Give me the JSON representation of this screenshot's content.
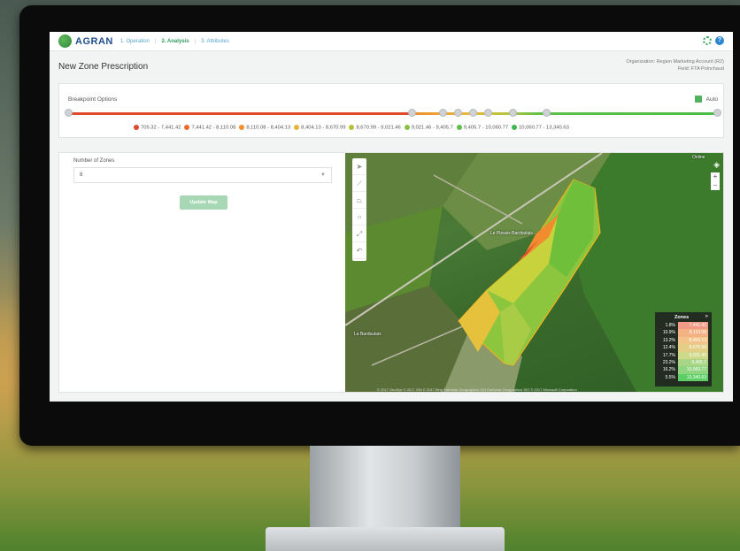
{
  "nav": {
    "brand": "AGRAN",
    "crumbs": [
      "1. Operation",
      "2. Analysis",
      "3. Attributes"
    ],
    "help": "?"
  },
  "header": {
    "title": "New Zone Prescription",
    "organization": "Organization: Region Marketing Account (R2)",
    "field": "Field: FTA Polnchaud"
  },
  "breakpoints": {
    "title": "Breakpoint Options",
    "auto_label": "Auto",
    "ranges": [
      {
        "label": "705.32 - 7,441.42",
        "color": "#e0492e"
      },
      {
        "label": "7,441.42 - 8,110.08",
        "color": "#ec6a2f"
      },
      {
        "label": "8,110.08 - 8,404.13",
        "color": "#f0902f"
      },
      {
        "label": "8,404.13 - 8,670.99",
        "color": "#e8b33a"
      },
      {
        "label": "8,670.99 - 9,021.46",
        "color": "#b7c13c"
      },
      {
        "label": "9,021.46 - 9,405.7",
        "color": "#88c243"
      },
      {
        "label": "9,405.7 - 10,060.77",
        "color": "#5cbf49"
      },
      {
        "label": "10,060.77 - 13,340.63",
        "color": "#3fb74a"
      }
    ]
  },
  "form": {
    "zones_label": "Number of Zones",
    "zones_value": "8",
    "update_button": "Update Map"
  },
  "map": {
    "labels": [
      "Le Plessis Bardoulais",
      "La Bardoulais",
      "Online"
    ],
    "zones_title": "Zones",
    "zones": [
      {
        "pct": "1.8%",
        "value": "7,441.42",
        "color": "#f19a86"
      },
      {
        "pct": "10.9%",
        "value": "8,110.08",
        "color": "#f4b184"
      },
      {
        "pct": "13.2%",
        "value": "8,404.13",
        "color": "#f3c48a"
      },
      {
        "pct": "12.4%",
        "value": "8,670.99",
        "color": "#e2cf85"
      },
      {
        "pct": "17.7%",
        "value": "9,021.46",
        "color": "#cfd98a"
      },
      {
        "pct": "23.2%",
        "value": "9,405.7",
        "color": "#a9d686"
      },
      {
        "pct": "16.2%",
        "value": "10,060.77",
        "color": "#8fd57f"
      },
      {
        "pct": "5.5%",
        "value": "13,340.63",
        "color": "#5ecf66"
      }
    ],
    "attribution": "© 2017 GeoEye © 2017 IGN © 2017 Bing Earthstar Geographics SIO Earthstar Geographics SIO © 2017 Microsoft Corporation"
  }
}
